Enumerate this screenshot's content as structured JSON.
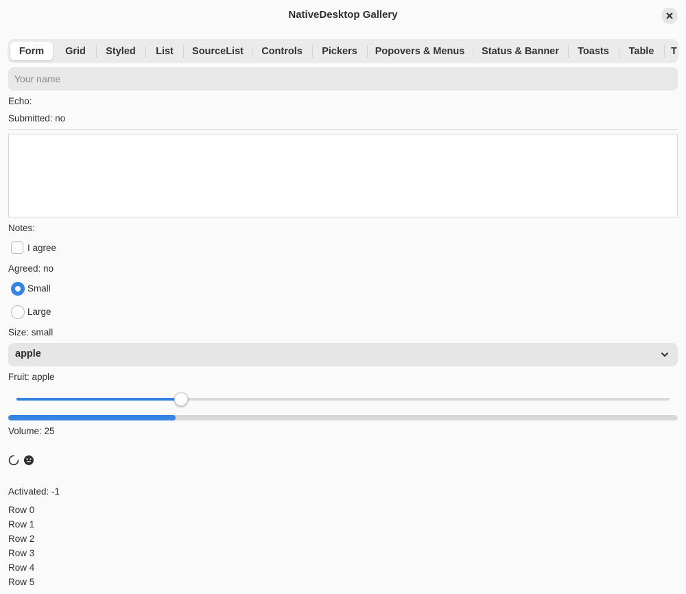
{
  "window": {
    "title": "NativeDesktop Gallery",
    "close_icon": "close-icon"
  },
  "tabs": [
    {
      "label": "Form",
      "active": true
    },
    {
      "label": "Grid",
      "active": false
    },
    {
      "label": "Styled",
      "active": false
    },
    {
      "label": "List",
      "active": false
    },
    {
      "label": "SourceList",
      "active": false
    },
    {
      "label": "Controls",
      "active": false
    },
    {
      "label": "Pickers",
      "active": false
    },
    {
      "label": "Popovers & Menus",
      "active": false
    },
    {
      "label": "Status & Banner",
      "active": false
    },
    {
      "label": "Toasts",
      "active": false
    },
    {
      "label": "Table",
      "active": false
    },
    {
      "label": "T",
      "active": false
    }
  ],
  "form": {
    "name_input": {
      "value": "",
      "placeholder": "Your name"
    },
    "echo": "Echo:",
    "submitted": "Submitted: no",
    "notes_value": "",
    "notes_label": "Notes:",
    "agree_label": "I agree",
    "agree_checked": false,
    "agreed": "Agreed: no",
    "size_options": [
      {
        "label": "Small",
        "selected": true
      },
      {
        "label": "Large",
        "selected": false
      }
    ],
    "size_status": "Size: small",
    "fruit_selected": "apple",
    "fruit_status": "Fruit: apple",
    "volume_slider_fraction": 0.25,
    "volume_progress_fraction": 0.25,
    "volume_status": "Volume: 25",
    "activated": "Activated: -1",
    "rows": [
      "Row 0",
      "Row 1",
      "Row 2",
      "Row 3",
      "Row 4",
      "Row 5"
    ]
  },
  "colors": {
    "accent": "#3584e4",
    "window_bg": "#fafafa",
    "input_bg": "#e8e8e8"
  }
}
